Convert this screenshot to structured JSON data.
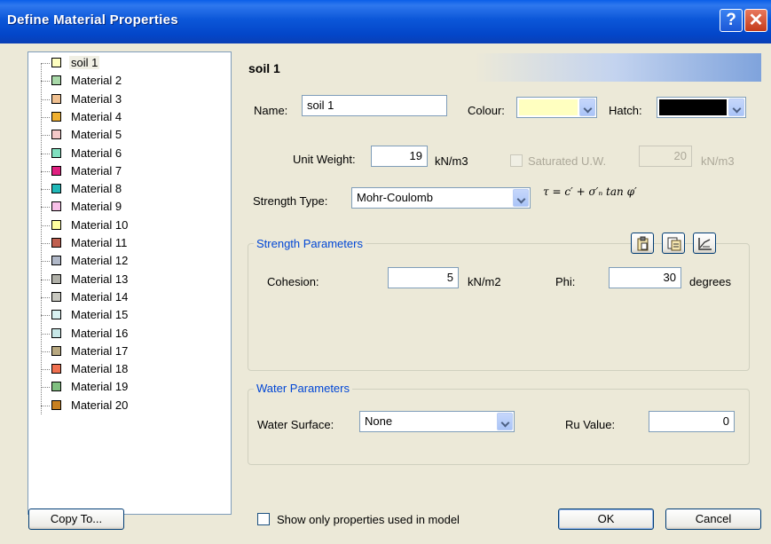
{
  "window": {
    "title": "Define Material Properties",
    "help_label": "?",
    "close_label": "✕"
  },
  "materials": [
    {
      "label": "soil 1",
      "color": "#ffffc0",
      "selected": true
    },
    {
      "label": "Material 2",
      "color": "#a8d8a8"
    },
    {
      "label": "Material 3",
      "color": "#f0c090"
    },
    {
      "label": "Material 4",
      "color": "#f0b030"
    },
    {
      "label": "Material 5",
      "color": "#f4c8c8"
    },
    {
      "label": "Material 6",
      "color": "#80e0c0"
    },
    {
      "label": "Material 7",
      "color": "#e02080"
    },
    {
      "label": "Material 8",
      "color": "#20b8b8"
    },
    {
      "label": "Material 9",
      "color": "#f8c0e8"
    },
    {
      "label": "Material 10",
      "color": "#ffffa0"
    },
    {
      "label": "Material 11",
      "color": "#c06050"
    },
    {
      "label": "Material 12",
      "color": "#b0b8c8"
    },
    {
      "label": "Material 13",
      "color": "#b0b0a8"
    },
    {
      "label": "Material 14",
      "color": "#c8c8c0"
    },
    {
      "label": "Material 15",
      "color": "#d8f0f0"
    },
    {
      "label": "Material 16",
      "color": "#c8e8e8"
    },
    {
      "label": "Material 17",
      "color": "#b8a880"
    },
    {
      "label": "Material 18",
      "color": "#f07050"
    },
    {
      "label": "Material 19",
      "color": "#80c080"
    },
    {
      "label": "Material 20",
      "color": "#c88020"
    }
  ],
  "panel": {
    "header_title": "soil 1",
    "name_label": "Name:",
    "name_value": "soil 1",
    "colour_label": "Colour:",
    "colour_value": "#ffffc0",
    "hatch_label": "Hatch:",
    "hatch_value": "#000000",
    "unit_weight_label": "Unit Weight:",
    "unit_weight_value": "19",
    "unit_weight_unit": "kN/m3",
    "saturated_label": "Saturated U.W.",
    "saturated_value": "20",
    "saturated_unit": "kN/m3",
    "strength_type_label": "Strength Type:",
    "strength_type_value": "Mohr-Coulomb",
    "formula": "τ = c′ + σ′ₙ tan φ′"
  },
  "strength": {
    "title": "Strength Parameters",
    "cohesion_label": "Cohesion:",
    "cohesion_value": "5",
    "cohesion_unit": "kN/m2",
    "phi_label": "Phi:",
    "phi_value": "30",
    "phi_unit": "degrees",
    "tool_icons": [
      "paste-parameters-icon",
      "copy-parameters-icon",
      "graph-strength-icon"
    ]
  },
  "water": {
    "title": "Water Parameters",
    "surface_label": "Water Surface:",
    "surface_value": "None",
    "ru_label": "Ru Value:",
    "ru_value": "0"
  },
  "footer": {
    "copy_to_label": "Copy To...",
    "show_only_label": "Show only properties used in model",
    "ok_label": "OK",
    "cancel_label": "Cancel"
  }
}
